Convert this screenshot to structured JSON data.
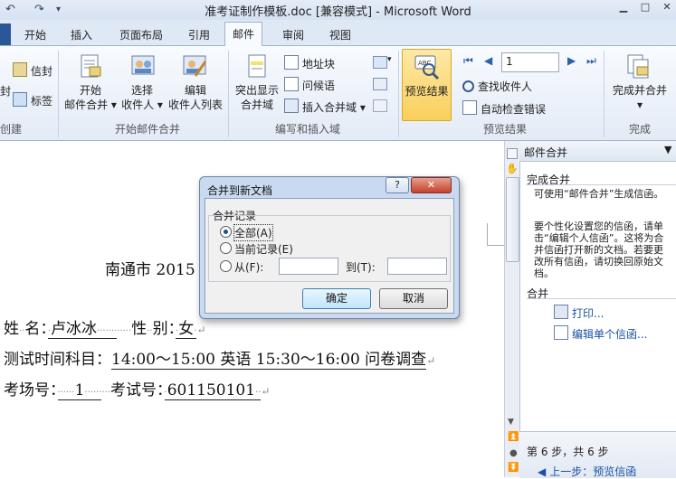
{
  "window": {
    "title": "准考证制作模板.doc [兼容模式] - Microsoft Word",
    "controls": {
      "minimize": "▁",
      "maximize": "□",
      "close": "✕"
    }
  },
  "quick_access": {
    "undo": "↶",
    "redo": "↷"
  },
  "tabs": [
    "开始",
    "插入",
    "页面布局",
    "引用",
    "邮件",
    "审阅",
    "视图"
  ],
  "active_tab": "邮件",
  "ribbon": {
    "create": {
      "label": "创建",
      "envelope": "信封",
      "labels": "标签",
      "clipped": "封"
    },
    "start_merge": {
      "label": "开始邮件合并",
      "start": [
        "开始",
        "邮件合并"
      ],
      "select": [
        "选择",
        "收件人"
      ],
      "edit": [
        "编辑",
        "收件人列表"
      ]
    },
    "write_insert": {
      "label": "编写和插入域",
      "highlight": [
        "突出显示",
        "合并域"
      ],
      "address_block": "地址块",
      "greeting": "问候语",
      "insert_field": "插入合并域"
    },
    "preview": {
      "label": "预览结果",
      "preview_button": "预览结果",
      "record_value": "1",
      "find_recipient": "查找收件人",
      "auto_check": "自动检查错误"
    },
    "finish": {
      "label": "完成",
      "finish_merge": "完成并合并"
    }
  },
  "document": {
    "heading_partial": "南通市 2015",
    "line1": {
      "name_label": "姓",
      "name_label2": "名：",
      "name_value": "卢冰冰",
      "sex_label": "性",
      "sex_label2": "别：",
      "sex_value": "女"
    },
    "line2": {
      "label": "测试时间科目：",
      "value": "14:00～15:00 英语 15:30～16:00 问卷调查"
    },
    "line3": {
      "room_label": "考场号：",
      "room_value": "1",
      "id_label": "考试号：",
      "id_value": "601150101"
    }
  },
  "task_pane": {
    "title": "邮件合并",
    "section_finish": "完成合并",
    "para1": "可使用“邮件合并”生成信函。",
    "para2": "要个性化设置您的信函，请单击“编辑个人信函”。这将为合并信函打开新的文档。若要更改所有信函，请切换回原始文档。",
    "section_merge": "合并",
    "print": "打印...",
    "edit_letters": "编辑单个信函...",
    "step": "第 6 步，共 6 步",
    "prev_step": "上一步：预览信函"
  },
  "dialog": {
    "title": "合并到新文档",
    "help": "?",
    "close": "✕",
    "group_label": "合并记录",
    "option_all": "全部(A)",
    "option_current": "当前记录(E)",
    "option_from": "从(F):",
    "to_label": "到(T):",
    "from_value": "",
    "to_value": "",
    "ok": "确定",
    "cancel": "取消",
    "selected": "all"
  }
}
